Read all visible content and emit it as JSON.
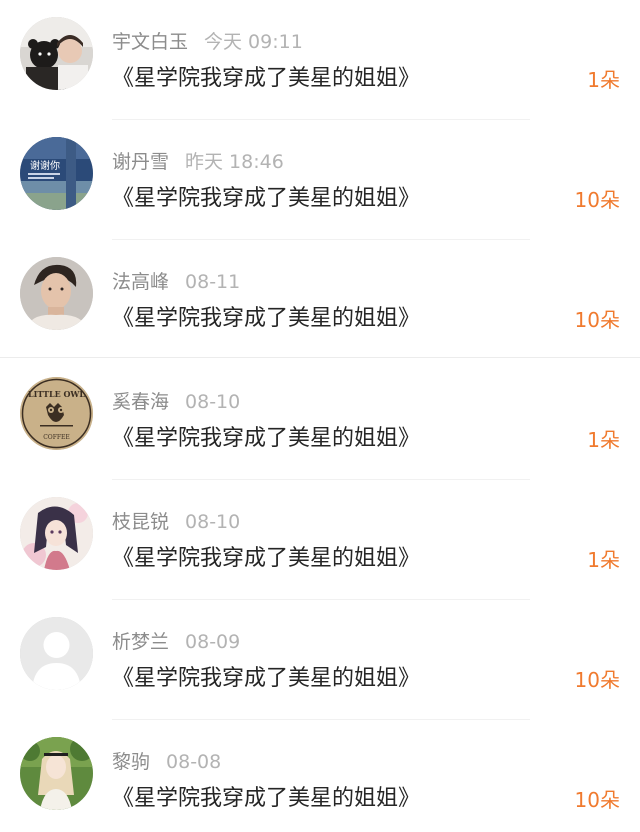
{
  "rows": [
    {
      "user": "宇文白玉",
      "time": "今天 09:11",
      "book": "《星学院我穿成了美星的姐姐》",
      "gift": "1朵",
      "avatar": "couple-bear-avatar"
    },
    {
      "user": "谢丹雪",
      "time": "昨天 18:46",
      "book": "《星学院我穿成了美星的姐姐》",
      "gift": "10朵",
      "avatar": "subway-station-avatar"
    },
    {
      "user": "法高峰",
      "time": "08-11",
      "book": "《星学院我穿成了美星的姐姐》",
      "gift": "10朵",
      "avatar": "young-man-portrait-avatar"
    },
    {
      "user": "奚春海",
      "time": "08-10",
      "book": "《星学院我穿成了美星的姐姐》",
      "gift": "1朵",
      "avatar": "little-owl-coffee-logo-avatar"
    },
    {
      "user": "枝昆锐",
      "time": "08-10",
      "book": "《星学院我穿成了美星的姐姐》",
      "gift": "1朵",
      "avatar": "anime-girl-avatar"
    },
    {
      "user": "析梦兰",
      "time": "08-09",
      "book": "《星学院我穿成了美星的姐姐》",
      "gift": "10朵",
      "avatar": "default-user-avatar"
    },
    {
      "user": "黎驹",
      "time": "08-08",
      "book": "《星学院我穿成了美星的姐姐》",
      "gift": "10朵",
      "avatar": "girl-in-garden-avatar"
    }
  ],
  "logo_text": {
    "top": "LITTLE OWL",
    "bottom": "COFFEE"
  },
  "avatar_sign_text": "谢谢你",
  "colors": {
    "gift": "#f07a2e",
    "title": "#262626",
    "name": "#8c8c8c",
    "time": "#b3b3b3"
  }
}
